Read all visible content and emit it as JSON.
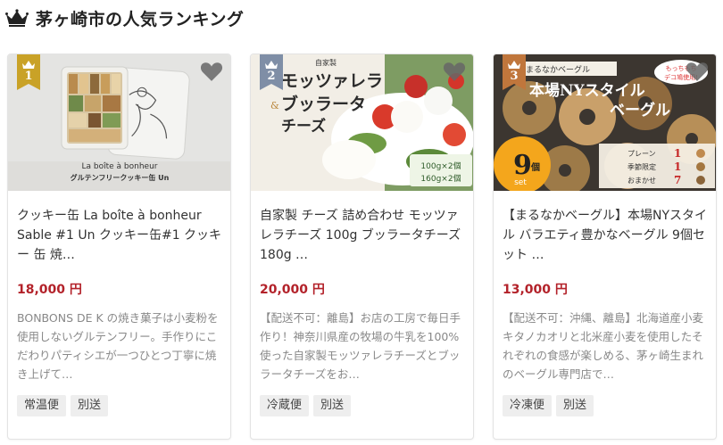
{
  "section": {
    "title": "茅ヶ崎市の人気ランキング"
  },
  "cards": [
    {
      "rank": "1",
      "badge_color": "#c9a227",
      "image_text": {
        "line1": "La boîte à bonheur",
        "line2": "グルテンフリークッキー缶 Un"
      },
      "title": "クッキー缶 La boîte à bonheur Sable #1 Un クッキー缶#1 クッキー 缶 焼…",
      "price": "18,000 円",
      "description": "BONBONS DE K の焼き菓子は小麦粉を使用しないグルテンフリー。手作りにこだわりパティシエが一つひとつ丁寧に焼き上げて…",
      "tags": [
        "常温便",
        "別送"
      ]
    },
    {
      "rank": "2",
      "badge_color": "#7f8ea6",
      "image_text": {
        "line1": "モッツァレラ",
        "line2": "ブッラータ",
        "line3": "チーズ",
        "small": "自家製",
        "amount1": "100g×2個",
        "amount2": "160g×2個"
      },
      "title": "自家製 チーズ 詰め合わせ モッツァレラチーズ 100g ブッラータチーズ180g …",
      "price": "20,000 円",
      "description": "【配送不可：離島】お店の工房で毎日手作り！神奈川県産の牧場の牛乳を100%使った自家製モッツァレラチーズとブッラータチーズをお…",
      "tags": [
        "冷蔵便",
        "別送"
      ]
    },
    {
      "rank": "3",
      "badge_color": "#c0763c",
      "image_text": {
        "brand": "まるなかベーグル",
        "line1": "本場NYスタイル",
        "line2": "ベーグル",
        "bubble": "もっちもち",
        "bubble2": "デコ鳩使用!",
        "count": "9",
        "unit": "個",
        "set": "set",
        "row1": "プレーン",
        "row2": "季節限定",
        "row3": "おまかせ",
        "n1": "1",
        "n2": "1",
        "n3": "7"
      },
      "title": "【まるなかベーグル】本場NYスタイル バラエティ豊かなベーグル 9個セット …",
      "price": "13,000 円",
      "description": "【配送不可：沖縄、離島】北海道産小麦キタノカオリと北米産小麦を使用したそれぞれの食感が楽しめる、茅ヶ崎生まれのベーグル専門店で…",
      "tags": [
        "冷凍便",
        "別送"
      ]
    }
  ]
}
